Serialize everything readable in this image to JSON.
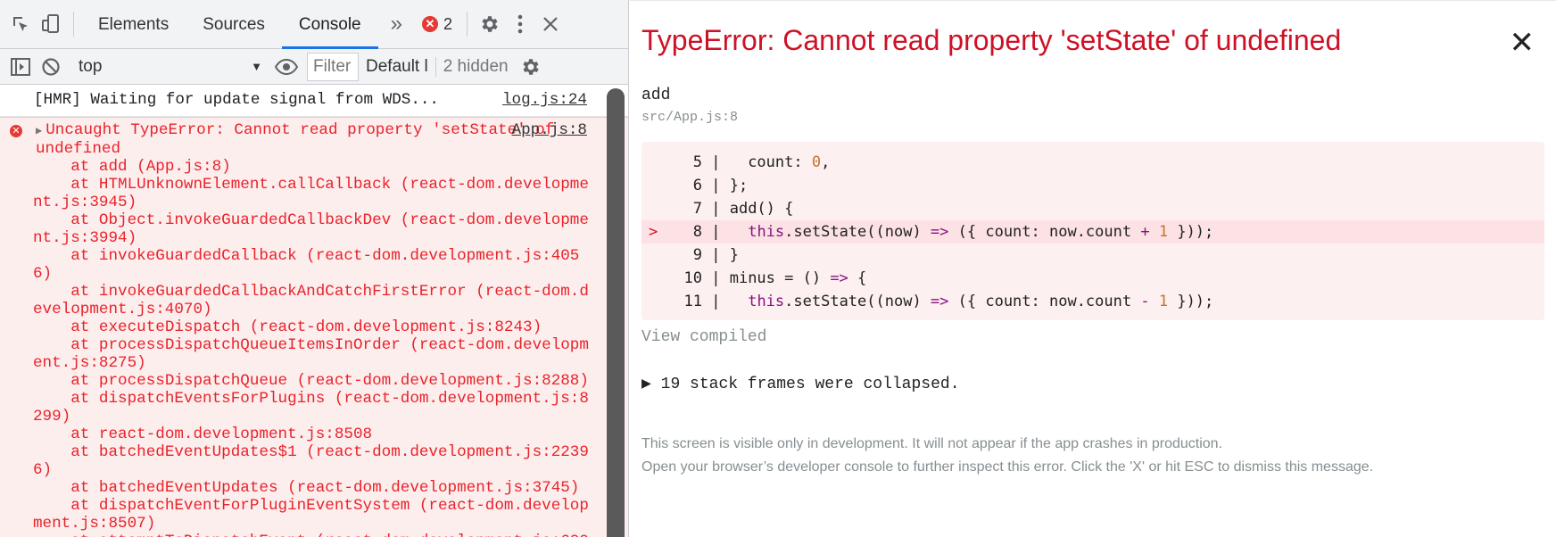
{
  "devtools": {
    "tabs": [
      "Elements",
      "Sources",
      "Console"
    ],
    "active_tab": "Console",
    "more_tabs": "»",
    "error_count": "2",
    "context": "top",
    "filter_placeholder": "Filter",
    "levels_label": "Default l",
    "hidden_label": "2 hidden",
    "log": {
      "text": "[HMR] Waiting for update signal from WDS...",
      "source": "log.js:24"
    },
    "error": {
      "source": "App.js:8",
      "head": "Uncaught TypeError: Cannot read property 'setState' of undefined",
      "trace": [
        "    at add (App.js:8)",
        "    at HTMLUnknownElement.callCallback (react-dom.development.js:3945)",
        "    at Object.invokeGuardedCallbackDev (react-dom.development.js:3994)",
        "    at invokeGuardedCallback (react-dom.development.js:4056)",
        "    at invokeGuardedCallbackAndCatchFirstError (react-dom.development.js:4070)",
        "    at executeDispatch (react-dom.development.js:8243)",
        "    at processDispatchQueueItemsInOrder (react-dom.development.js:8275)",
        "    at processDispatchQueue (react-dom.development.js:8288)",
        "    at dispatchEventsForPlugins (react-dom.development.js:8299)",
        "    at react-dom.development.js:8508",
        "    at batchedEventUpdates$1 (react-dom.development.js:22396)",
        "    at batchedEventUpdates (react-dom.development.js:3745)",
        "    at dispatchEventForPluginEventSystem (react-dom.development.js:8507)",
        "    at attemptToDispatchEvent (react-dom.development.js:609"
      ]
    }
  },
  "overlay": {
    "title": "TypeError: Cannot read property 'setState' of undefined",
    "close": "✕",
    "function_name": "add",
    "function_src": "src/App.js:8",
    "code": [
      {
        "n": "5",
        "marker": "",
        "text": "  count: 0,"
      },
      {
        "n": "6",
        "marker": "",
        "text": "};"
      },
      {
        "n": "7",
        "marker": "",
        "text": "add() {"
      },
      {
        "n": "8",
        "marker": ">",
        "text": "  this.setState((now) => ({ count: now.count + 1 }));"
      },
      {
        "n": "9",
        "marker": "",
        "text": "}"
      },
      {
        "n": "10",
        "marker": "",
        "text": "minus = () => {"
      },
      {
        "n": "11",
        "marker": "",
        "text": "  this.setState((now) => ({ count: now.count - 1 }));"
      }
    ],
    "view_compiled": "View compiled",
    "collapsed_frames": "▶ 19 stack frames were collapsed.",
    "footer_line1": "This screen is visible only in development. It will not appear if the app crashes in production.",
    "footer_line2": "Open your browser’s developer console to further inspect this error.  Click the 'X' or hit ESC to dismiss this message."
  }
}
